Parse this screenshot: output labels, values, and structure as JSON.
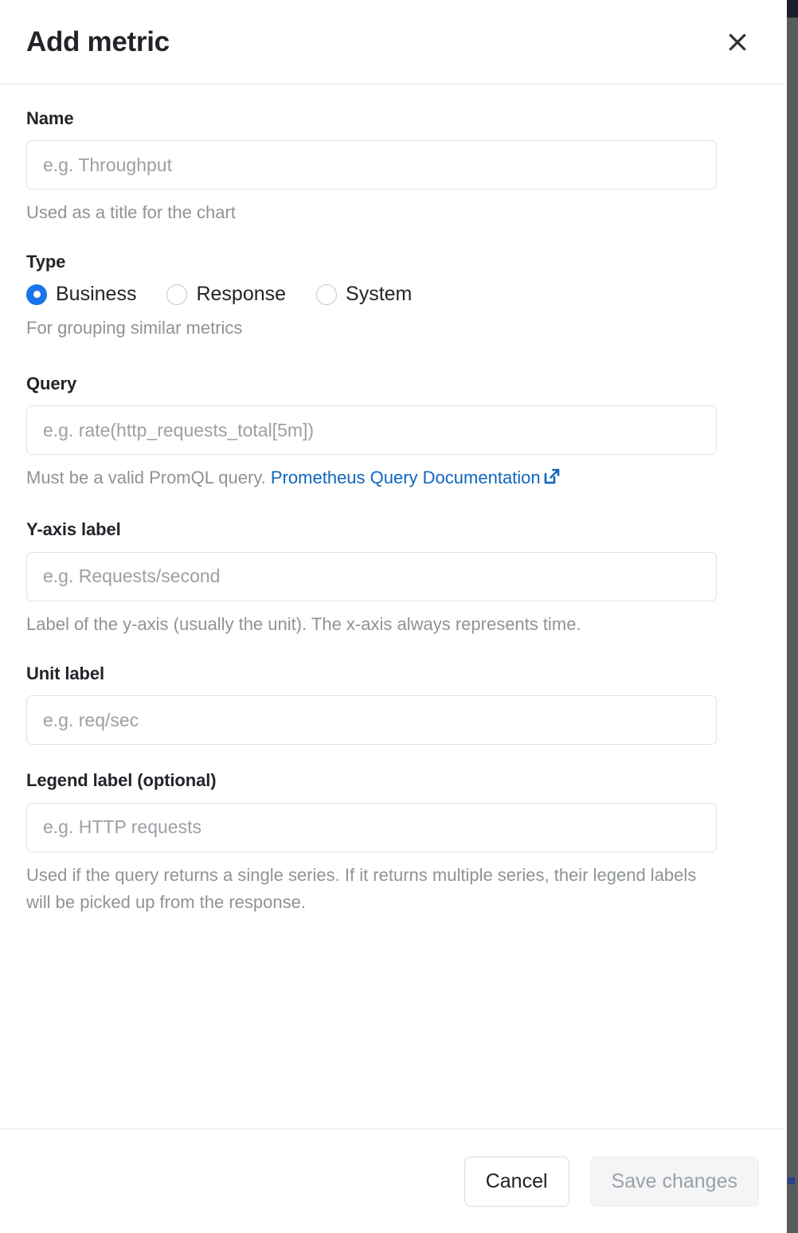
{
  "dialog": {
    "title": "Add metric",
    "close_icon": "close-icon"
  },
  "fields": {
    "name": {
      "label": "Name",
      "value": "",
      "placeholder": "e.g. Throughput",
      "help": "Used as a title for the chart"
    },
    "type": {
      "label": "Type",
      "help": "For grouping similar metrics",
      "selected": "Business",
      "options": [
        {
          "label": "Business",
          "checked": true
        },
        {
          "label": "Response",
          "checked": false
        },
        {
          "label": "System",
          "checked": false
        }
      ]
    },
    "query": {
      "label": "Query",
      "value": "",
      "placeholder": "e.g. rate(http_requests_total[5m])",
      "help_prefix": "Must be a valid PromQL query.",
      "help_link": "Prometheus Query Documentation",
      "help_link_icon": "external-link-icon"
    },
    "yaxis": {
      "label": "Y-axis label",
      "value": "",
      "placeholder": "e.g. Requests/second",
      "help": "Label of the y-axis (usually the unit). The x-axis always represents time."
    },
    "unit": {
      "label": "Unit label",
      "value": "",
      "placeholder": "e.g. req/sec"
    },
    "legend": {
      "label": "Legend label (optional)",
      "value": "",
      "placeholder": "e.g. HTTP requests",
      "help": "Used if the query returns a single series. If it returns multiple series, their legend labels will be picked up from the response."
    }
  },
  "footer": {
    "cancel_label": "Cancel",
    "save_label": "Save changes",
    "save_disabled": true
  },
  "colors": {
    "accent_blue": "#1a73e8",
    "link_blue": "#1066bf",
    "text": "#212529",
    "muted_text": "#8e9396",
    "border": "#dee2e6",
    "divider": "#e3e3e3",
    "disabled_bg": "#f4f5f6"
  }
}
